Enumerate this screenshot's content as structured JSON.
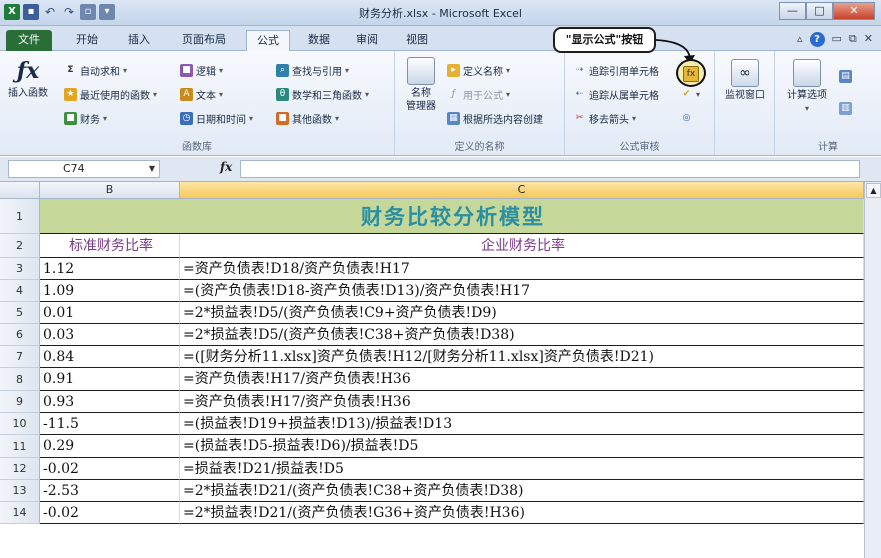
{
  "window": {
    "title": "财务分析.xlsx - Microsoft Excel",
    "controls": {
      "minimize": "—",
      "maximize": "□",
      "close": "✕"
    }
  },
  "ribbon_tabs": [
    "文件",
    "开始",
    "插入",
    "页面布局",
    "公式",
    "数据",
    "审阅",
    "视图"
  ],
  "active_tab": "公式",
  "ribbon": {
    "function_library": {
      "insert_function": "插入函数",
      "autosum": "自动求和",
      "recent": "最近使用的函数",
      "financial": "财务",
      "logical": "逻辑",
      "text": "文本",
      "datetime": "日期和时间",
      "lookup": "查找与引用",
      "math": "数学和三角函数",
      "more": "其他函数",
      "label": "函数库"
    },
    "defined_names": {
      "name_manager_1": "名称",
      "name_manager_2": "管理器",
      "define_name": "定义名称",
      "use_in_formula": "用于公式",
      "create_from_selection": "根据所选内容创建",
      "label": "定义的名称"
    },
    "formula_auditing": {
      "trace_precedents": "追踪引用单元格",
      "trace_dependents": "追踪从属单元格",
      "remove_arrows": "移去箭头",
      "label": "公式审核"
    },
    "watch_window": "监视窗口",
    "calculation": {
      "options": "计算选项",
      "label": "计算"
    },
    "callout": "\"显示公式\"按钮"
  },
  "formula_bar": {
    "name_box": "C74",
    "fx": "fx",
    "value": ""
  },
  "columns": {
    "b": "B",
    "c": "C"
  },
  "sheet": {
    "title": "财务比较分析模型",
    "header_b": "标准财务比率",
    "header_c": "企业财务比率",
    "row_numbers": [
      "1",
      "2",
      "3",
      "4",
      "5",
      "6",
      "7",
      "8",
      "9",
      "10",
      "11",
      "12",
      "13",
      "14"
    ],
    "rows": [
      {
        "b": "1.12",
        "c": "=资产负债表!D18/资产负债表!H17"
      },
      {
        "b": "1.09",
        "c": "=(资产负债表!D18-资产负债表!D13)/资产负债表!H17"
      },
      {
        "b": "0.01",
        "c": "=2*损益表!D5/(资产负债表!C9+资产负债表!D9)"
      },
      {
        "b": "0.03",
        "c": "=2*损益表!D5/(资产负债表!C38+资产负债表!D38)"
      },
      {
        "b": "0.84",
        "c": "=([财务分析11.xlsx]资产负债表!H12/[财务分析11.xlsx]资产负债表!D21)"
      },
      {
        "b": "0.91",
        "c": "=资产负债表!H17/资产负债表!H36"
      },
      {
        "b": "0.93",
        "c": "=资产负债表!H17/资产负债表!H36"
      },
      {
        "b": "-11.5",
        "c": "=(损益表!D19+损益表!D13)/损益表!D13"
      },
      {
        "b": "0.29",
        "c": "=(损益表!D5-损益表!D6)/损益表!D5"
      },
      {
        "b": "-0.02",
        "c": "=损益表!D21/损益表!D5"
      },
      {
        "b": "-2.53",
        "c": "=2*损益表!D21/(资产负债表!C38+资产负债表!D38)"
      },
      {
        "b": "-0.02",
        "c": "=2*损益表!D21/(资产负债表!G36+资产负债表!H36)"
      }
    ]
  },
  "colors": {
    "title_fill": "#c5d89a",
    "title_text": "#2a8fa0",
    "header_text": "#7a3a8a",
    "file_tab": "#2a6e37",
    "selected_col": "#f6c85b"
  }
}
